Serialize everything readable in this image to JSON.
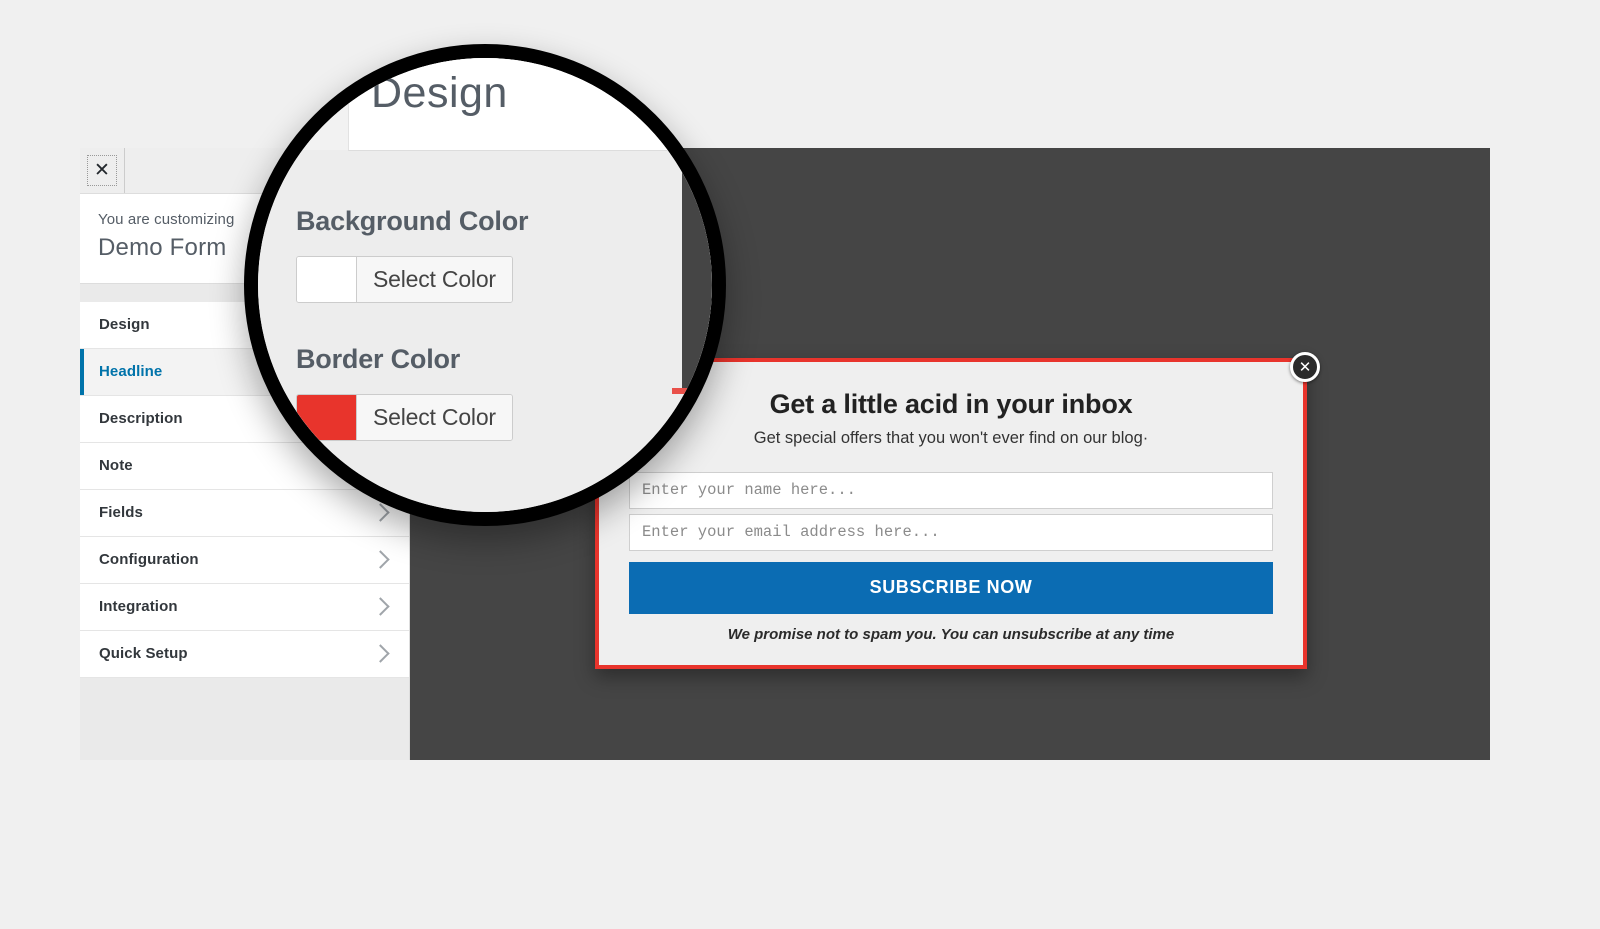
{
  "page": {
    "background_color": "#f0f0f0"
  },
  "customizer": {
    "close_icon": "close-x-icon",
    "close_glyph": "✕",
    "info_label": "You are customizing",
    "info_title": "Demo Form",
    "nav_items": [
      {
        "label": "Design",
        "active": false,
        "has_chevron": false
      },
      {
        "label": "Headline",
        "active": true,
        "has_chevron": false
      },
      {
        "label": "Description",
        "active": false,
        "has_chevron": false
      },
      {
        "label": "Note",
        "active": false,
        "has_chevron": false
      },
      {
        "label": "Fields",
        "active": false,
        "has_chevron": true
      },
      {
        "label": "Configuration",
        "active": false,
        "has_chevron": true
      },
      {
        "label": "Integration",
        "active": false,
        "has_chevron": true
      },
      {
        "label": "Quick Setup",
        "active": false,
        "has_chevron": true
      }
    ],
    "accent_color": "#0073aa"
  },
  "magnifier": {
    "panel_title": "Design",
    "background_color_label": "Background Color",
    "background_color_button": "Select Color",
    "background_swatch_color": "#ffffff",
    "border_color_label": "Border Color",
    "border_color_button": "Select Color",
    "border_swatch_color": "#e8342c"
  },
  "preview": {
    "background_color": "#454545",
    "popup": {
      "headline": "Get a little acid in your inbox",
      "description": "Get special offers that you won't ever find on our blog·",
      "name_placeholder": "Enter your name here...",
      "email_placeholder": "Enter your email address here...",
      "name_value": "",
      "email_value": "",
      "subscribe_label": "SUBSCRIBE NOW",
      "footnote": "We promise not to spam you. You can unsubscribe at any time",
      "border_color": "#e8342c",
      "button_color": "#0b6cb3",
      "close_icon": "close-x-icon",
      "close_glyph": "✕"
    }
  }
}
